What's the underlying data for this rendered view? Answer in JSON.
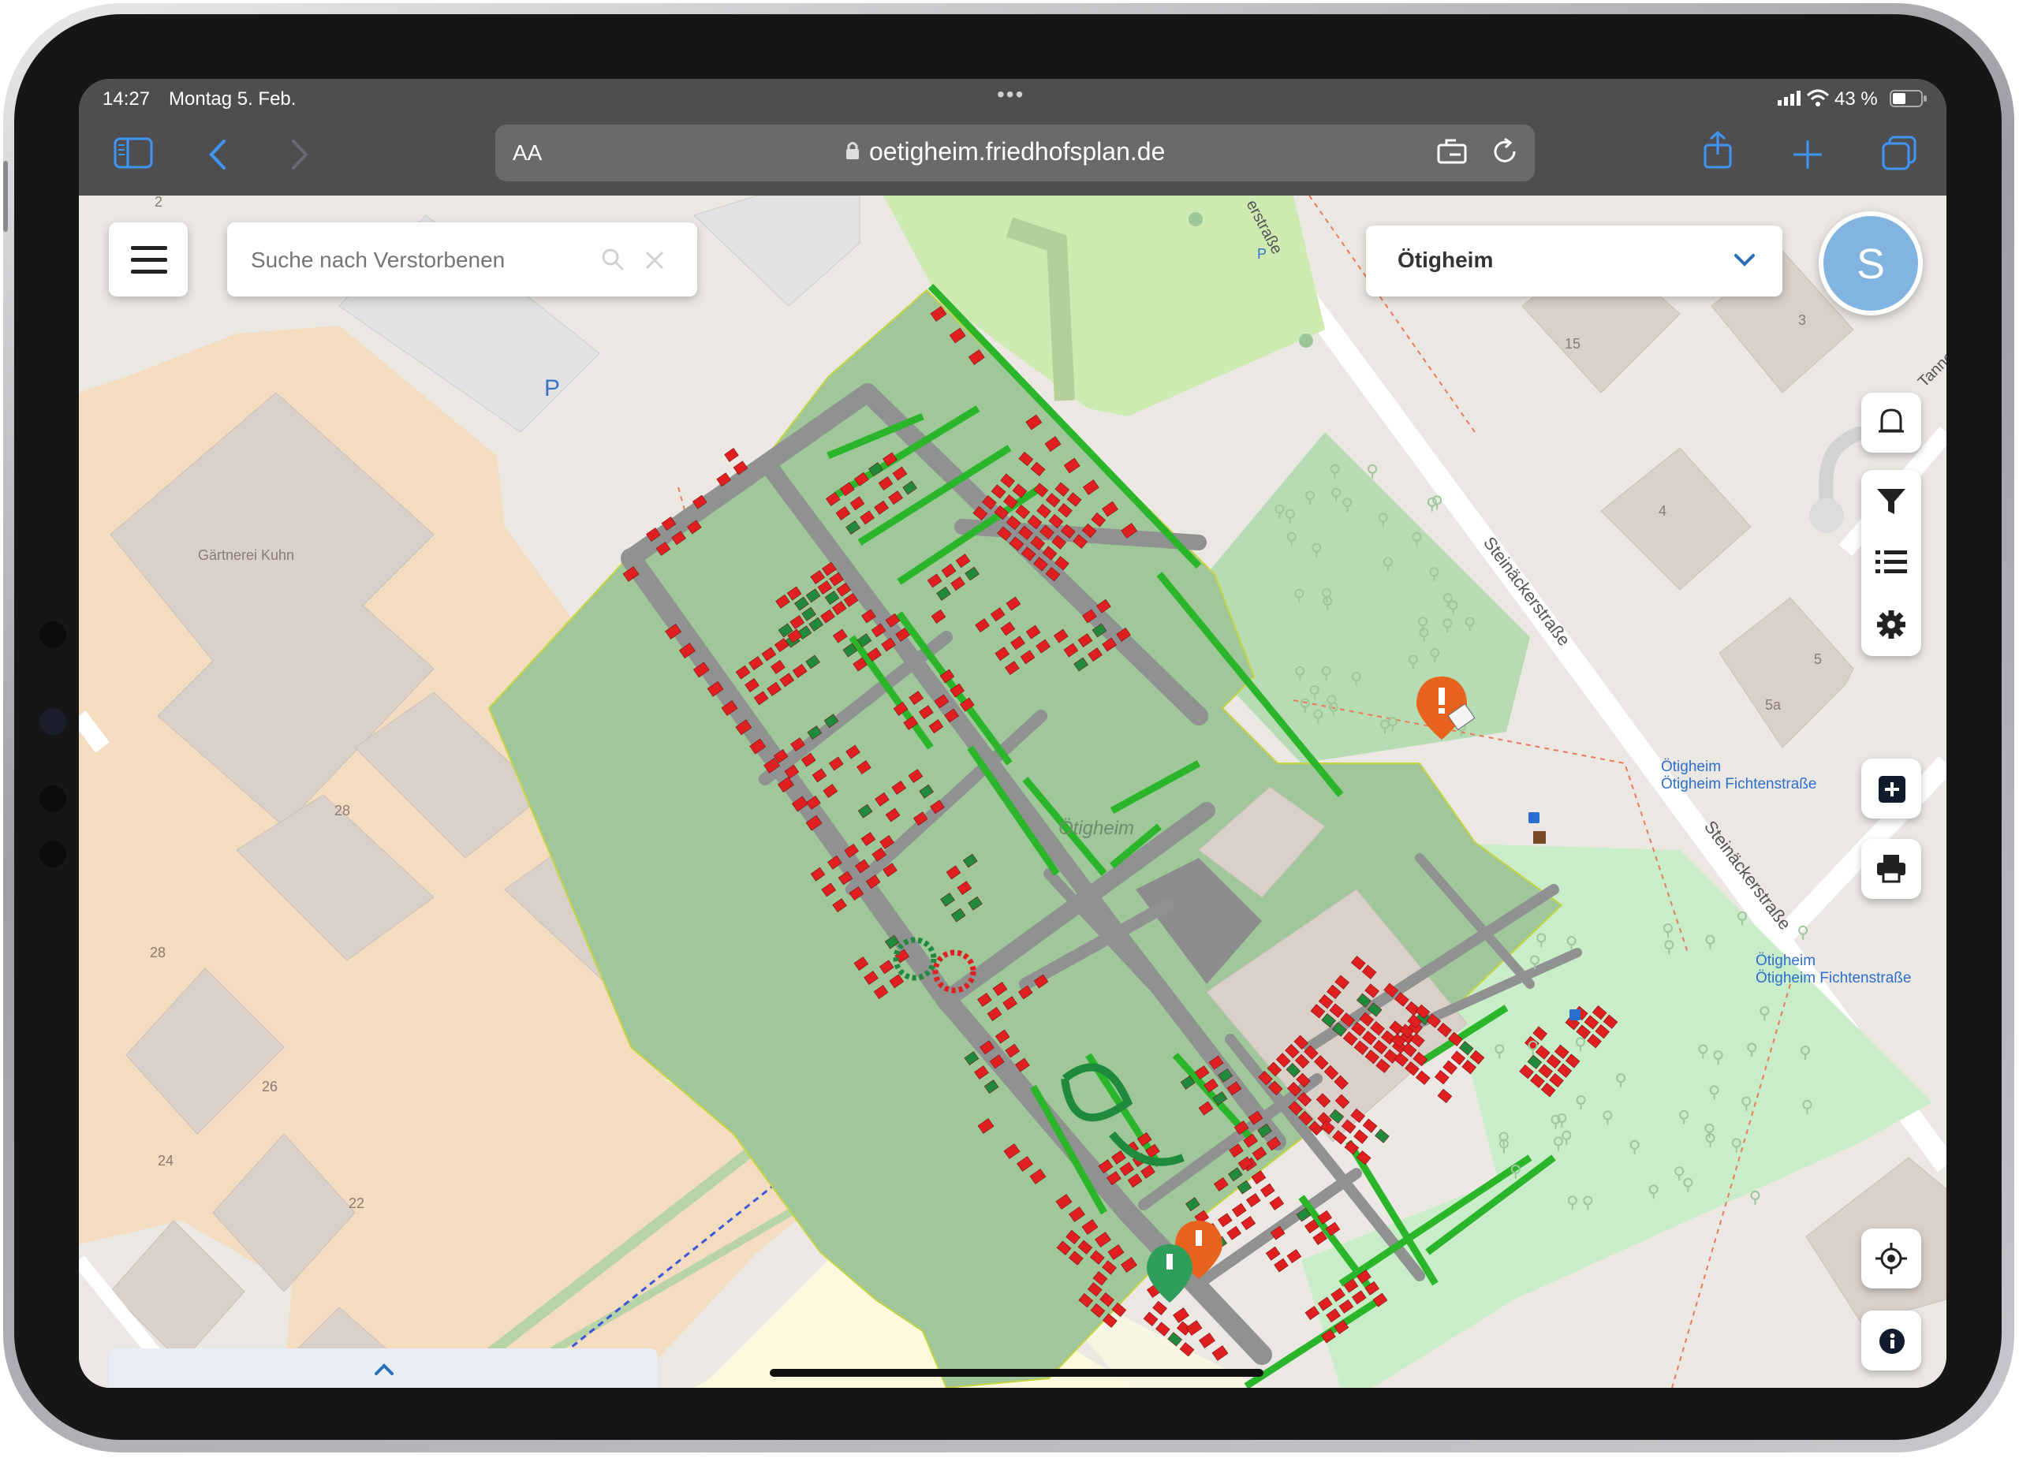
{
  "status_bar": {
    "time": "14:27",
    "date": "Montag 5. Feb.",
    "battery": "43 %"
  },
  "browser": {
    "text_size_label": "AA",
    "url": "oetigheim.friedhofsplan.de"
  },
  "app": {
    "search_placeholder": "Suche nach Verstorbenen",
    "location_selected": "Ötigheim",
    "avatar_initial": "S"
  },
  "map": {
    "poi_gaertnerei": "Gärtnerei Kuhn",
    "street_steinaecker": "Steinäckerstraße",
    "street_tanne": "Tanne",
    "street_partial": "erstraße",
    "bus_stop_label": "Ötigheim Fichtenstraße",
    "cemetery_label": "Ötigheim",
    "parking": "P",
    "house_numbers": {
      "n2": "2",
      "n15": "15",
      "n3": "3",
      "n4": "4",
      "n5": "5",
      "n5a": "5a",
      "n28a": "28",
      "n28b": "28",
      "n26": "26",
      "n24": "24",
      "n22": "22"
    }
  },
  "colors": {
    "accent": "#3f95f6",
    "occupied": "#e02020",
    "free": "#1f8a3c",
    "avatar": "#82b4e1",
    "marker_orange": "#e8641e",
    "marker_green": "#2e9e5a"
  }
}
